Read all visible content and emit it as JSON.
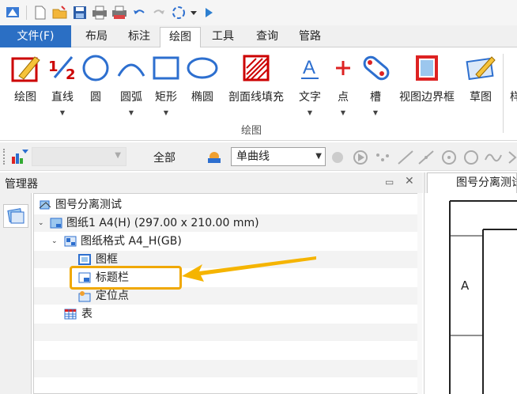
{
  "ribbon_tabs": {
    "file": "文件(F)",
    "layout": "布局",
    "annotate": "标注",
    "draw": "绘图",
    "tools": "工具",
    "query": "查询",
    "pipe": "管路"
  },
  "ribbon_buttons": {
    "draw": "绘图",
    "line": "直线",
    "circle": "圆",
    "arc": "圆弧",
    "rectangle": "矩形",
    "ellipse": "椭圆",
    "hatch": "剖面线填充",
    "text": "文字",
    "point": "点",
    "slot": "槽",
    "view_border": "视图边界框",
    "sketch": "草图",
    "more": "样"
  },
  "ribbon_group_label": "绘图",
  "filter_toolbar": {
    "scope": "全部",
    "curve_select": "单曲线"
  },
  "manager": {
    "title": "管理器"
  },
  "tree": {
    "root": "图号分离测试",
    "sheet": "图纸1 A4(H) (297.00 x 210.00 mm)",
    "format": "图纸格式 A4_H(GB)",
    "frame": "图框",
    "title_block": "标题栏",
    "locator": "定位点",
    "table": "表"
  },
  "document": {
    "tab_title": "图号分离测试",
    "zone_label": "A"
  },
  "colors": {
    "file_tab": "#2b6fc4",
    "highlight": "#f0a800"
  }
}
